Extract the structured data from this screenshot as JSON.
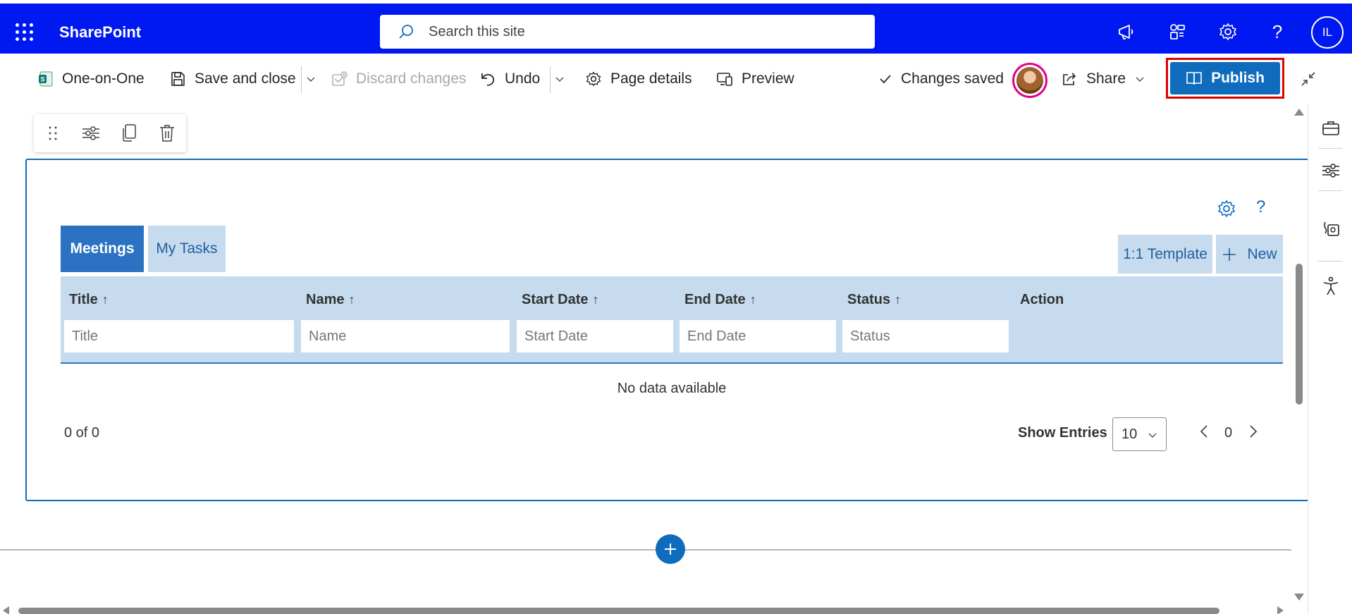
{
  "suitebar": {
    "brand": "SharePoint",
    "search_placeholder": "Search this site",
    "user_initials": "IL",
    "background": "#0019f0"
  },
  "commandbar": {
    "page_name": "One-on-One",
    "save_close": "Save and close",
    "discard": "Discard changes",
    "undo": "Undo",
    "page_details": "Page details",
    "preview": "Preview",
    "status": "Changes saved",
    "share": "Share",
    "publish": "Publish"
  },
  "toolbox": {
    "icons": [
      "drag-handle-icon",
      "edit-properties-icon",
      "duplicate-icon",
      "delete-icon"
    ]
  },
  "webpart": {
    "tabs": [
      {
        "label": "Meetings",
        "active": true
      },
      {
        "label": "My Tasks",
        "active": false
      }
    ],
    "template_button": "1:1 Template",
    "new_button": "New",
    "columns": [
      {
        "label": "Title",
        "sortable": true,
        "filter_placeholder": "Title"
      },
      {
        "label": "Name",
        "sortable": true,
        "filter_placeholder": "Name"
      },
      {
        "label": "Start Date",
        "sortable": true,
        "filter_placeholder": "Start Date"
      },
      {
        "label": "End Date",
        "sortable": true,
        "filter_placeholder": "End Date"
      },
      {
        "label": "Status",
        "sortable": true,
        "filter_placeholder": "Status"
      },
      {
        "label": "Action",
        "sortable": false
      }
    ],
    "sort_arrow": "↑",
    "empty_message": "No data available",
    "record_count": "0 of 0",
    "show_entries_label": "Show Entries",
    "entries_value": "10",
    "page_number": "0",
    "help_glyph": "?"
  },
  "colors": {
    "accent": "#0f6cbd",
    "header_bg": "#c6dbee",
    "active_tab": "#2b73c2",
    "publish_highlight": "#e00000"
  }
}
